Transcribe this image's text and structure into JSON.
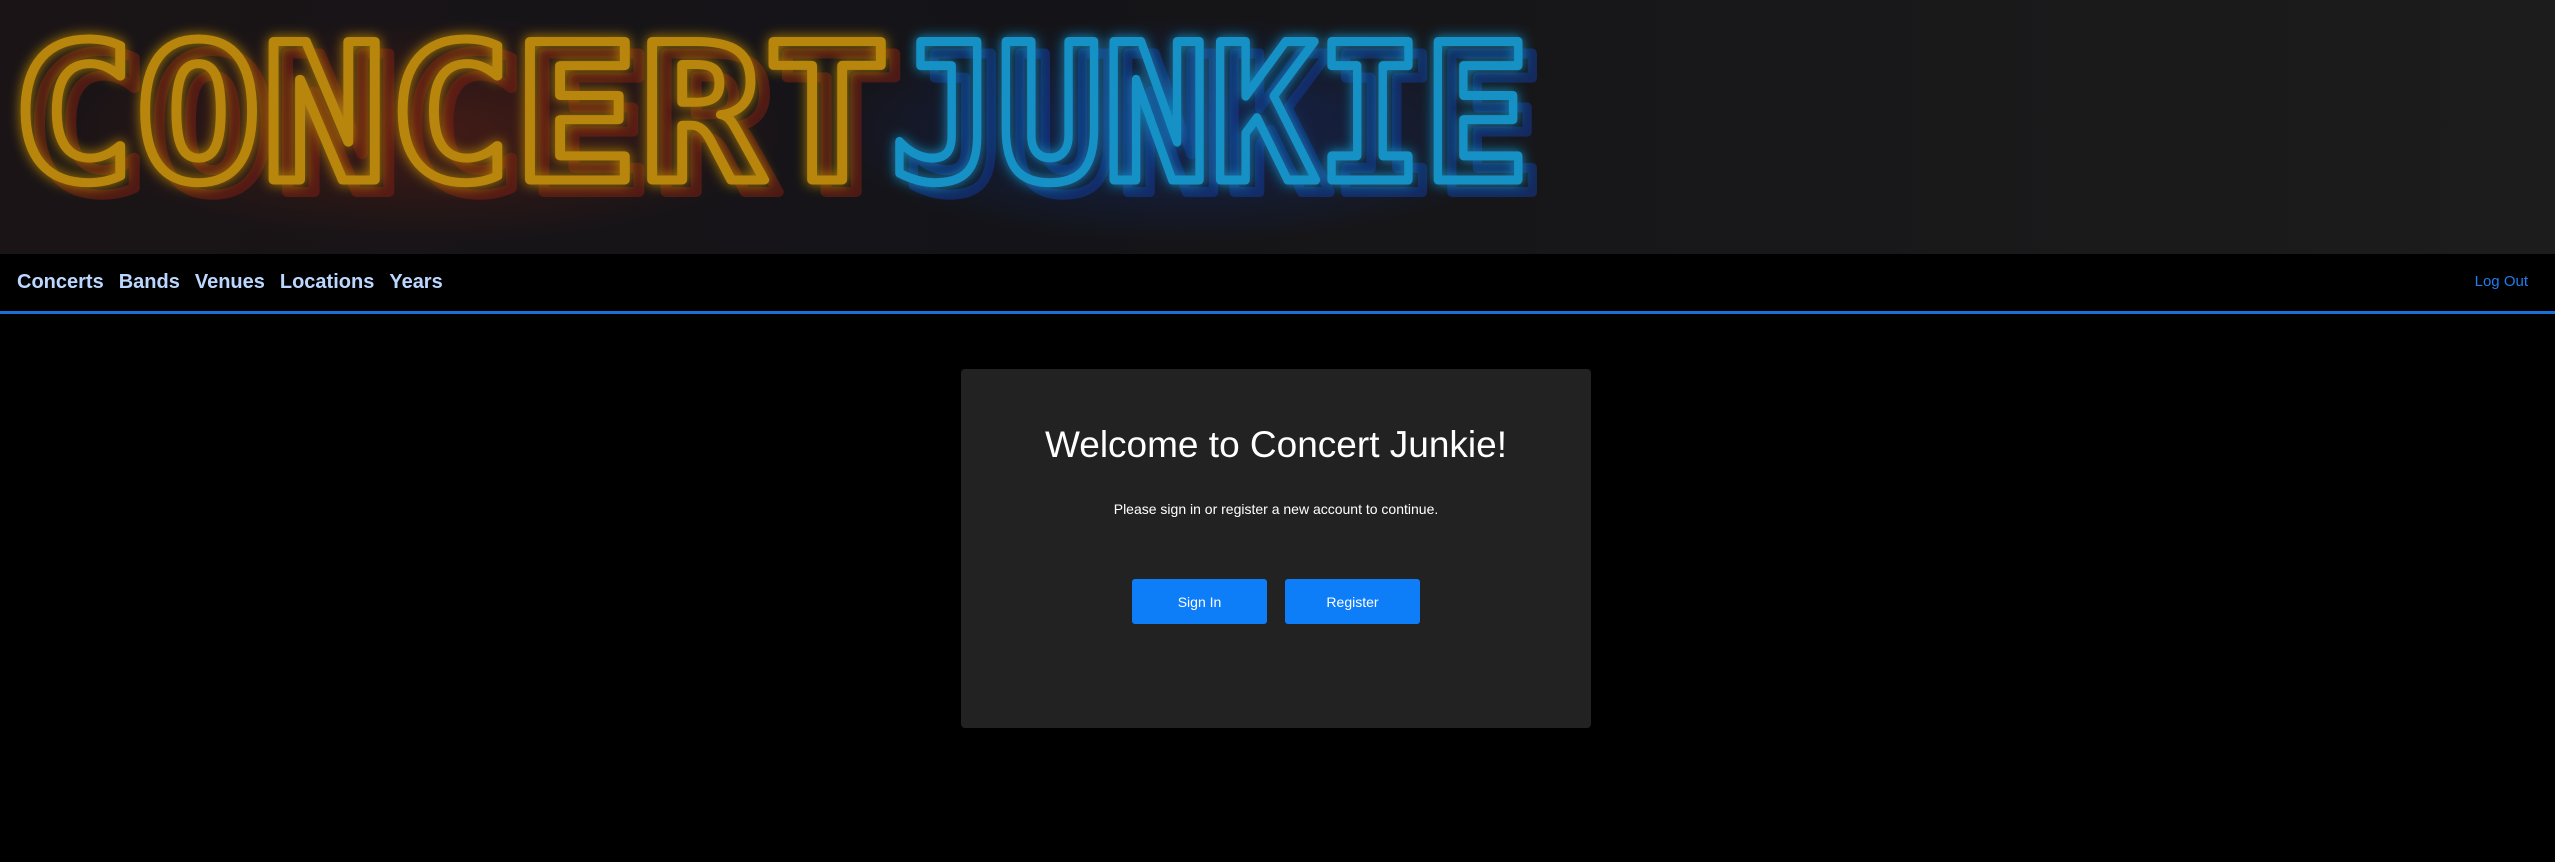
{
  "banner": {
    "logo_text_left": "CONCERT",
    "logo_text_right": "JUNKIE",
    "left_color": "#b8860b",
    "left_glow": "#c0391b",
    "right_color": "#1591c6",
    "right_glow": "#1d47c9"
  },
  "nav": {
    "items": [
      {
        "label": "Concerts"
      },
      {
        "label": "Bands"
      },
      {
        "label": "Venues"
      },
      {
        "label": "Locations"
      },
      {
        "label": "Years"
      }
    ],
    "logout_label": "Log Out",
    "link_color": "#bcd7ff",
    "accent_color": "#1a6fd8"
  },
  "welcome": {
    "title": "Welcome to Concert Junkie!",
    "subtitle": "Please sign in or register a new account to continue.",
    "signin_label": "Sign In",
    "register_label": "Register",
    "button_color": "#0d7df8"
  }
}
